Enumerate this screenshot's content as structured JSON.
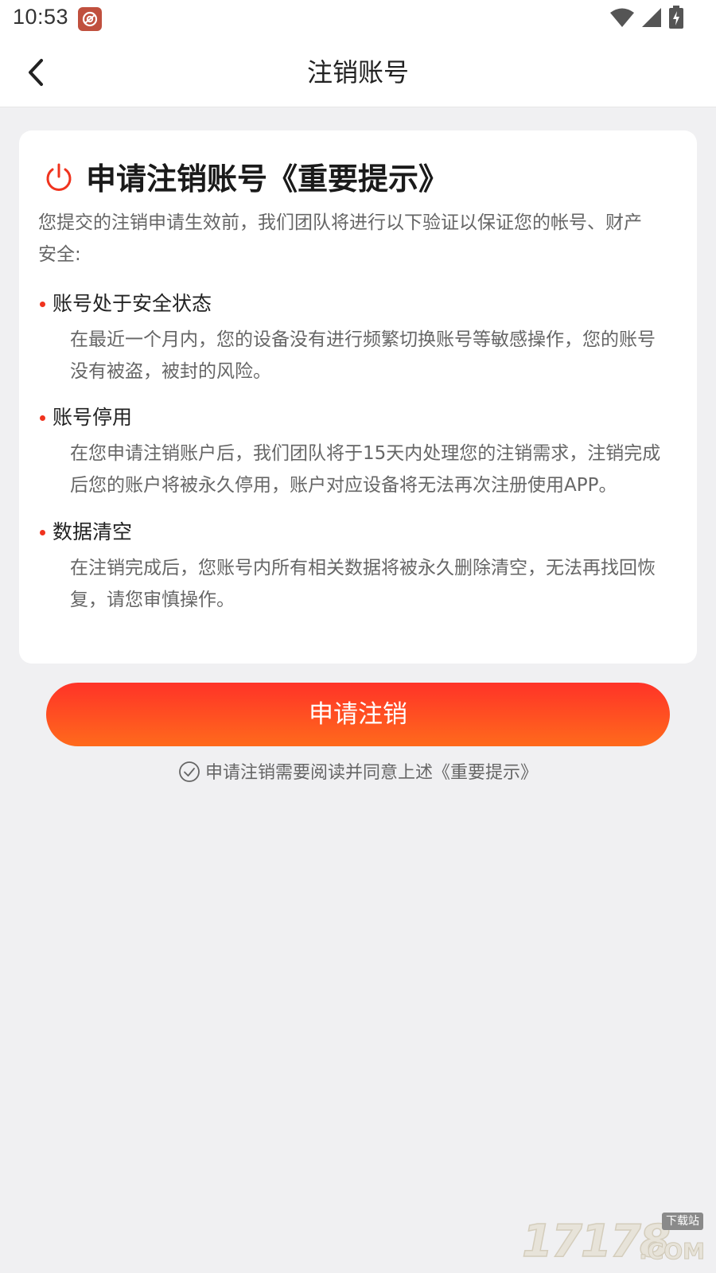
{
  "status_bar": {
    "time": "10:53",
    "icons": [
      "app-notification-icon",
      "wifi-icon",
      "cellular-signal-icon",
      "battery-charging-icon"
    ]
  },
  "nav": {
    "back_icon": "chevron-left-icon",
    "title": "注销账号"
  },
  "card": {
    "icon": "power-icon",
    "title": "申请注销账号《重要提示》",
    "intro_line1": "您提交的注销申请生效前，我们团队将进行以下验证以保证您的帐号、财产",
    "intro_line2": "安全:",
    "items": [
      {
        "title": "账号处于安全状态",
        "desc_line1": "在最近一个月内，您的设备没有进行频繁切换账号等敏感操作，您的账号",
        "desc_line2": "没有被盗，被封的风险。"
      },
      {
        "title": "账号停用",
        "desc_line1": "在您申请注销账户后，我们团队将于15天内处理您的注销需求，注销完成",
        "desc_line2": "后您的账户将被永久停用，账户对应设备将无法再次注册使用APP。"
      },
      {
        "title": "数据清空",
        "desc_line1": "在注销完成后，您账号内所有相关数据将被永久删除清空，无法再找回恢",
        "desc_line2": "复，请您审慎操作。"
      }
    ]
  },
  "apply_button_label": "申请注销",
  "agreement": {
    "icon": "check-circle-icon",
    "text": "申请注销需要阅读并同意上述《重要提示》"
  },
  "watermark": {
    "number": "17178",
    "tag": "下载站",
    "com": ".COM"
  },
  "colors": {
    "accent": "#f0331e",
    "button_gradient_top": "#ff3328",
    "button_gradient_bottom": "#ff6a1c",
    "page_background": "#f0f0f2"
  }
}
